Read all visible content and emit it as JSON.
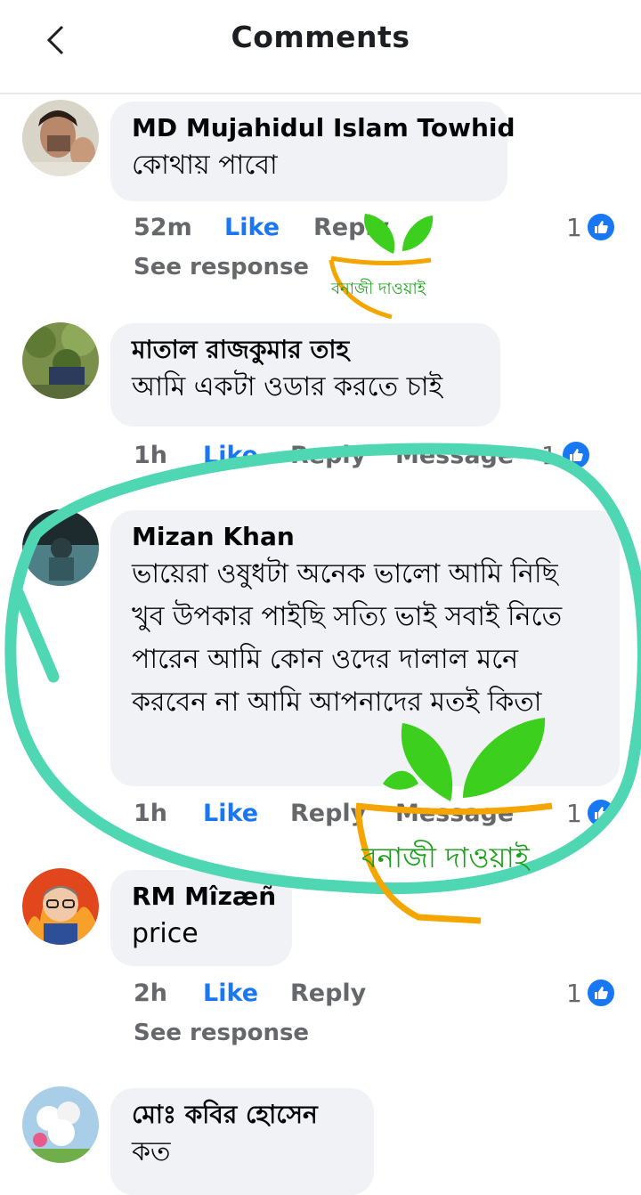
{
  "header": {
    "title": "Comments",
    "back_icon": "chevron-left-icon"
  },
  "comments": [
    {
      "name": "MD Mujahidul Islam Towhid",
      "text": "কোথায় পাবো",
      "time": "52m",
      "like": "Like",
      "reply": "Reply",
      "reactions": "1",
      "see_response": "See response"
    },
    {
      "name": "মাতাল রাজকুমার তাহ",
      "text": "আমি একটা ওডার করতে চাই",
      "time": "1h",
      "like": "Like",
      "reply": "Reply",
      "message": "Message",
      "reactions": "1"
    },
    {
      "name": "Mizan Khan",
      "text": "ভায়েরা ওষুধটা অনেক ভালো আমি নিছি খুব উপকার পাইছি সত্যি ভাই সবাই নিতে পারেন আমি কোন ওদের দালাল মনে করবেন না আমি আপনাদের মতই কিতা",
      "time": "1h",
      "like": "Like",
      "reply": "Reply",
      "message": "Message",
      "reactions": "1"
    },
    {
      "name": "RM Mîzæñ",
      "text": "price",
      "time": "2h",
      "like": "Like",
      "reply": "Reply",
      "reactions": "1",
      "see_response": "See response"
    },
    {
      "name": "মোঃ কবির হোসেন",
      "text": "কত"
    }
  ],
  "watermark": {
    "text": "বনাজী দাওয়াই"
  },
  "colors": {
    "link": "#1877f2",
    "meta": "#65676b",
    "bubble": "#f0f2f5",
    "annotation": "#4fd6b2",
    "leaf": "#3ccf1e",
    "pot": "#f5a500"
  }
}
